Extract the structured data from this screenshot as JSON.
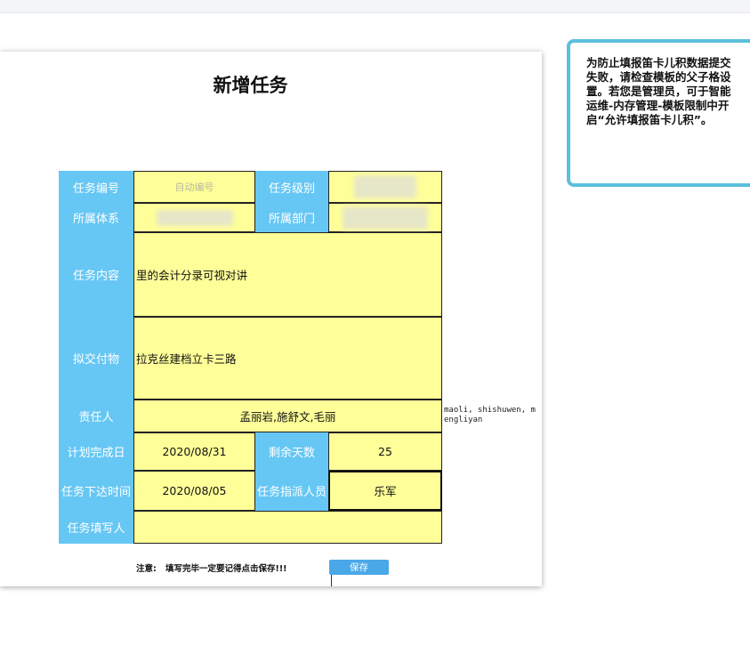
{
  "form": {
    "title": "新增任务",
    "labels": {
      "task_no": "任务编号",
      "task_level": "任务级别",
      "system": "所属体系",
      "department": "所属部门",
      "content": "任务内容",
      "deliverable": "拟交付物",
      "owner": "责任人",
      "due_date": "计划完成日",
      "remaining": "剩余天数",
      "issue_date": "任务下达时间",
      "assigner": "任务指派人员",
      "filler": "任务填写人"
    },
    "values": {
      "task_no_placeholder": "自动编号",
      "content": "里的会计分录可视对讲",
      "deliverable": "拉克丝建档立卡三路",
      "owner": "孟丽岩,施舒文,毛丽",
      "owner_ids": "maoli, shishuwen, mengliyan",
      "due_date": "2020/08/31",
      "remaining": "25",
      "issue_date": "2020/08/05",
      "assigner": "乐军",
      "filler": ""
    },
    "footer": {
      "note_label": "注意:",
      "note_text": "填写完毕一定要记得点击保存!!!",
      "save": "保存"
    }
  },
  "tip": {
    "text": "为防止填报笛卡儿积数据提交失败，请检查模板的父子格设置。若您是管理员，可于智能运维-内存管理-模板限制中开启“允许填报笛卡儿积”。"
  },
  "colors": {
    "label_bg": "#66c7f4",
    "value_bg": "#ffff99",
    "button_bg": "#4aa8e8",
    "tip_border": "#5bc0de"
  }
}
